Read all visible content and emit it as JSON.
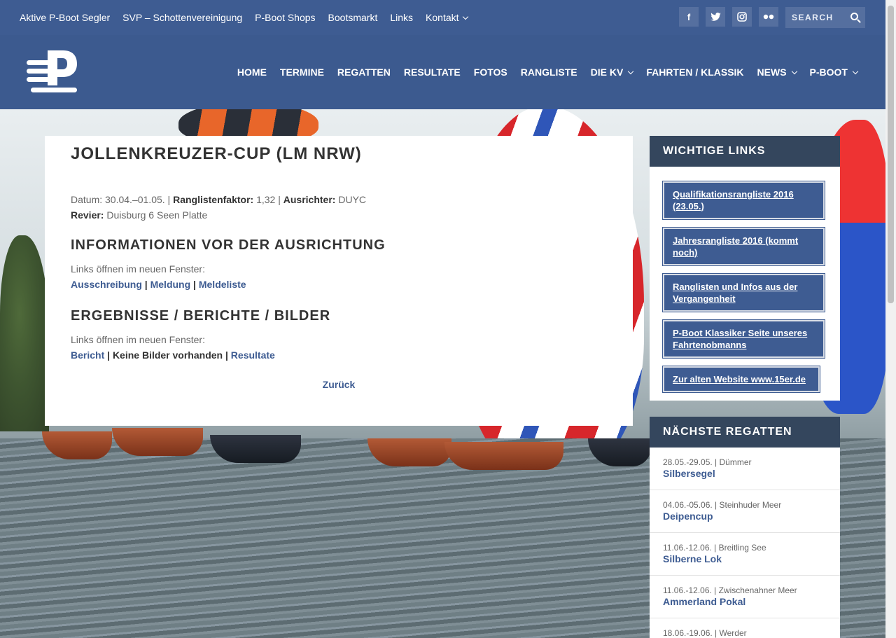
{
  "topnav": [
    {
      "label": "Aktive P-Boot Segler",
      "dropdown": false
    },
    {
      "label": "SVP – Schottenvereinigung",
      "dropdown": false
    },
    {
      "label": "P-Boot Shops",
      "dropdown": false
    },
    {
      "label": "Bootsmarkt",
      "dropdown": false
    },
    {
      "label": "Links",
      "dropdown": false
    },
    {
      "label": "Kontakt",
      "dropdown": true
    }
  ],
  "social": {
    "facebook": "f",
    "twitter": "t",
    "instagram": "i",
    "flickr": "••"
  },
  "search": {
    "placeholder": "SEARCH"
  },
  "mainnav": [
    {
      "label": "HOME"
    },
    {
      "label": "TERMINE"
    },
    {
      "label": "REGATTEN"
    },
    {
      "label": "RESULTATE"
    },
    {
      "label": "FOTOS"
    },
    {
      "label": "RANGLISTE"
    },
    {
      "label": "DIE KV"
    },
    {
      "label": "FAHRTEN / KLASSIK"
    },
    {
      "label": "NEWS"
    },
    {
      "label": "P-BOOT"
    }
  ],
  "article": {
    "title": "JOLLENKREUZER-CUP (LM NRW)",
    "datum_label": "Datum:",
    "datum": "30.04.–01.05.",
    "sep": "|",
    "faktor_label": "Ranglistenfaktor:",
    "faktor": "1,32",
    "ausrichter_label": "Ausrichter:",
    "ausrichter": "DUYC",
    "revier_label": "Revier:",
    "revier": "Duisburg 6 Seen Platte",
    "section1_title": "INFORMATIONEN VOR DER AUSRICHTUNG",
    "section1_note": "Links öffnen im neuen Fenster:",
    "link_ausschreibung": "Ausschreibung",
    "link_meldung": "Meldung",
    "link_meldeliste": "Meldeliste",
    "section2_title": "ERGEBNISSE / BERICHTE / BILDER",
    "section2_note": "Links öffnen im neuen Fenster:",
    "link_bericht": "Bericht",
    "no_images": "Keine Bilder vorhanden",
    "link_resultate": "Resultate",
    "back": "Zurück"
  },
  "sidebar": {
    "links_title": "WICHTIGE LINKS",
    "links": [
      "Qualifikationsrangliste 2016 (23.05.)",
      "Jahresrangliste 2016 (kommt noch)",
      "Ranglisten und Infos aus der Vergangenheit",
      "P-Boot Klassiker Seite unseres Fahrtenobmanns",
      "Zur alten Website www.15er.de"
    ],
    "regatten_title": "NÄCHSTE REGATTEN",
    "regatten": [
      {
        "date": "28.05.-29.05. | Dümmer",
        "name": "Silbersegel"
      },
      {
        "date": "04.06.-05.06. | Steinhuder Meer",
        "name": "Deipencup"
      },
      {
        "date": "11.06.-12.06. | Breitling See",
        "name": "Silberne Lok"
      },
      {
        "date": "11.06.-12.06. | Zwischenahner Meer",
        "name": "Ammerland Pokal"
      },
      {
        "date": "18.06.-19.06. | Werder",
        "name": ""
      }
    ]
  },
  "colors": {
    "brand": "#3e5c92",
    "widget_header": "#34465d"
  }
}
